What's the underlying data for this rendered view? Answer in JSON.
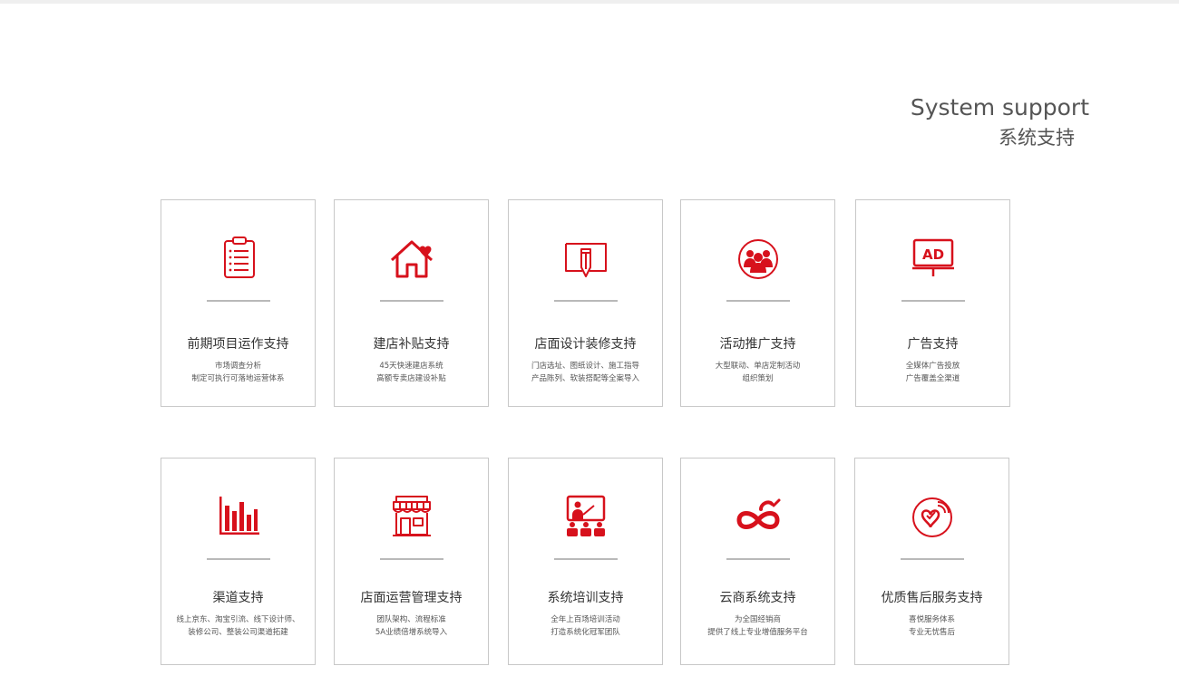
{
  "header": {
    "title_en": "System support",
    "title_cn": "系统支持"
  },
  "colors": {
    "accent": "#d7111c",
    "border": "#c8c8c8",
    "divider": "#b9b9b9",
    "text": "#333333"
  },
  "cards": [
    {
      "icon": "clipboard-checklist-icon",
      "title": "前期项目运作支持",
      "desc": [
        "市场调查分析",
        "制定可执行可落地运营体系"
      ]
    },
    {
      "icon": "house-heart-icon",
      "title": "建店补贴支持",
      "desc": [
        "45天快速建店系统",
        "高额专卖店建设补贴"
      ]
    },
    {
      "icon": "design-pencil-icon",
      "title": "店面设计装修支持",
      "desc": [
        "门店选址、图纸设计、施工指导",
        "产品陈列、软装搭配等全案导入"
      ]
    },
    {
      "icon": "group-people-icon",
      "title": "活动推广支持",
      "desc": [
        "大型联动、单店定制活动",
        "组织策划"
      ]
    },
    {
      "icon": "ad-billboard-icon",
      "title": "广告支持",
      "desc": [
        "全媒体广告投放",
        "广告覆盖全渠道"
      ]
    },
    {
      "icon": "bar-chart-icon",
      "title": "渠道支持",
      "desc": [
        "线上京东、淘宝引流、线下设计师、",
        "装修公司、整装公司渠道拓建"
      ]
    },
    {
      "icon": "storefront-icon",
      "title": "店面运营管理支持",
      "desc": [
        "团队架构、流程标准",
        "5A业绩倍增系统导入"
      ]
    },
    {
      "icon": "training-presentation-icon",
      "title": "系统培训支持",
      "desc": [
        "全年上百场培训活动",
        "打造系统化冠军团队"
      ]
    },
    {
      "icon": "cloud-infinity-icon",
      "title": "云商系统支持",
      "desc": [
        "为全国经销商",
        "提供了线上专业增值服务平台"
      ]
    },
    {
      "icon": "heart-service-icon",
      "title": "优质售后服务支持",
      "desc": [
        "喜悦服务体系",
        "专业无忧售后"
      ]
    }
  ]
}
